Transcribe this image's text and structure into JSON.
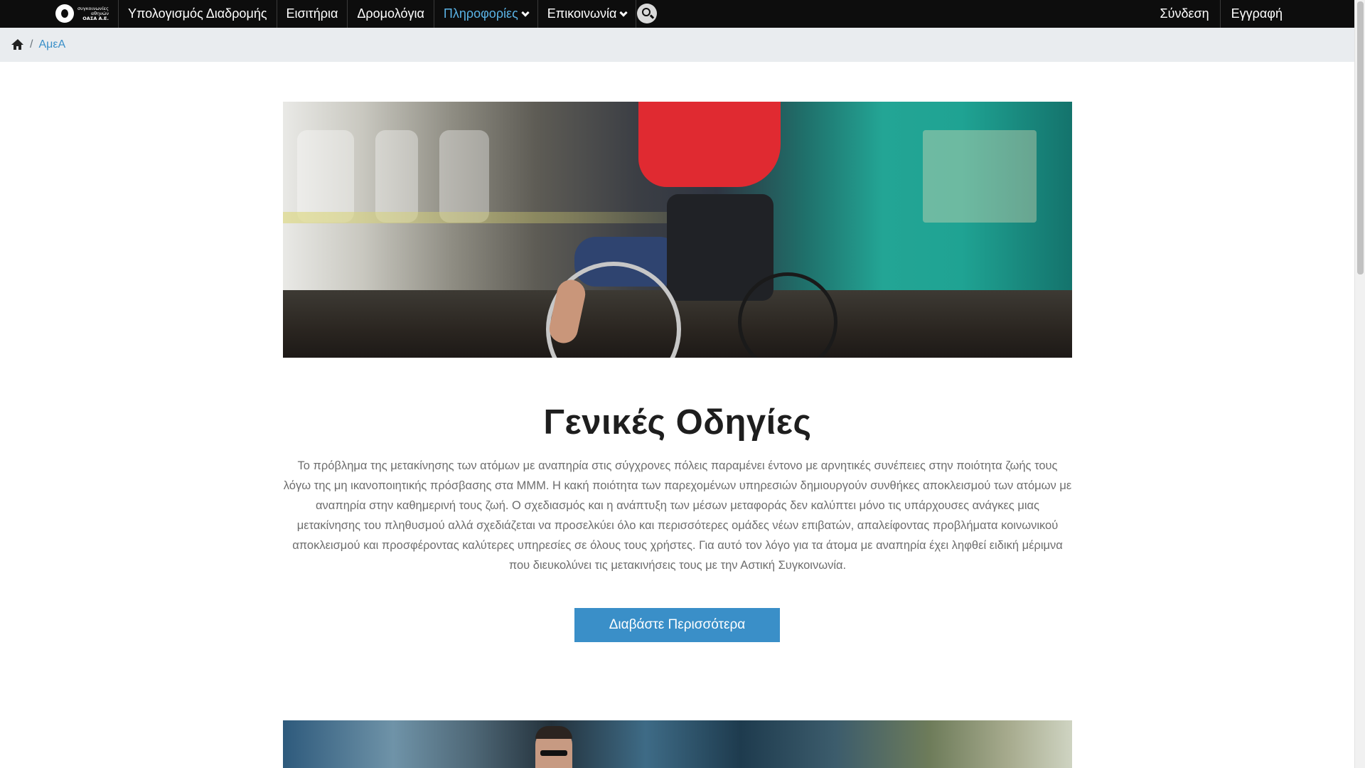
{
  "logo": {
    "line1": "συγκοινωνίες",
    "line2": "αθηνών",
    "line3": "ΟΑΣΑ Α.Ε."
  },
  "nav": {
    "items": [
      {
        "label": "Υπολογισμός Διαδρομής"
      },
      {
        "label": "Εισιτήρια"
      },
      {
        "label": "Δρομολόγια"
      },
      {
        "label": "Πληροφορίες",
        "active": true
      },
      {
        "label": "Επικοινωνία"
      }
    ],
    "search_icon": "search-icon",
    "login": "Σύνδεση",
    "register": "Εγγραφή"
  },
  "breadcrumb": {
    "home_icon": "home-icon",
    "separator": "/",
    "current": "ΑμεΑ"
  },
  "main": {
    "title": "Γενικές Οδηγίες",
    "body": "Το πρόβλημα της μετακίνησης των ατόμων με αναπηρία στις σύγχρονες πόλεις παραμένει έντονο με αρνητικές συνέπειες στην ποιότητα ζωής τους λόγω της μη ικανοποιητικής πρόσβασης στα ΜΜΜ. Η κακή ποιότητα των παρεχομένων υπηρεσιών δημιουργούν συνθήκες αποκλεισμού των ατόμων με αναπηρία στην καθημερινή τους ζωή. Ο σχεδιασμός και η ανάπτυξη των μέσων μεταφοράς δεν καλύπτει μόνο τις υπάρχουσες ανάγκες μιας μετακίνησης του πληθυσμού αλλά σχεδιάζεται να προσελκύει όλο και περισσότερες ομάδες νέων επιβατών, απαλείφοντας προβλήματα κοινωνικού αποκλεισμού και προσφέροντας καλύτερες υπηρεσίες σε όλους τους χρήστες. Για αυτό τον λόγο για τα άτομα με αναπηρία έχει ληφθεί ειδική μέριμνα που διευκολύνει τις μετακινήσεις τους με την Αστική Συγκοινωνία.",
    "button": "Διαβάστε Περισσότερα"
  },
  "colors": {
    "nav_bg": "#0d0d0d",
    "accent": "#3a8fc8",
    "active_nav": "#5ab3e6",
    "breadcrumb_bg": "#e9ecef"
  }
}
